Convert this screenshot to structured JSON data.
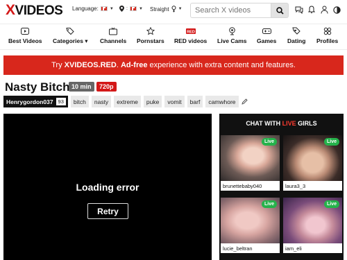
{
  "header": {
    "logo_x": "X",
    "logo_rest": "VIDEOS",
    "language_label": "Language:",
    "location_label": "▾",
    "orientation_label": "Straight",
    "search_placeholder": "Search X videos"
  },
  "nav": {
    "items": [
      {
        "label": "Best Videos",
        "icon": "play-box-icon"
      },
      {
        "label": "Categories ▾",
        "icon": "tags-icon"
      },
      {
        "label": "Channels",
        "icon": "tv-icon"
      },
      {
        "label": "Pornstars",
        "icon": "star-icon"
      },
      {
        "label": "RED videos",
        "icon": "red-badge-icon"
      },
      {
        "label": "Live Cams",
        "icon": "webcam-icon"
      },
      {
        "label": "Games",
        "icon": "gamepad-icon"
      },
      {
        "label": "Dating",
        "icon": "heart-tag-icon"
      },
      {
        "label": "Profiles",
        "icon": "profiles-icon"
      }
    ]
  },
  "promo": {
    "pre": "Try ",
    "brand": "XVIDEOS.RED",
    "mid": ". ",
    "bold": "Ad-free",
    "post": " experience with extra content and features."
  },
  "video": {
    "title": "Nasty Bitch",
    "duration": "10 min",
    "quality": "720p",
    "uploader": "Henrygordon037",
    "uploader_count": "93",
    "tags": [
      "bitch",
      "nasty",
      "extreme",
      "puke",
      "vomit",
      "barf",
      "camwhore"
    ]
  },
  "player": {
    "error_text": "Loading error",
    "retry_label": "Retry"
  },
  "live": {
    "head_pre": "CHAT WITH ",
    "head_red": "LIVE",
    "head_post": " GIRLS",
    "pill": "Live",
    "cams": [
      {
        "name": "brunettebaby040"
      },
      {
        "name": "laura3_3"
      },
      {
        "name": "lucie_beltran"
      },
      {
        "name": "iam_eli"
      }
    ]
  },
  "colors": {
    "brand_red": "#d31818",
    "promo_red": "#d8271c",
    "live_green": "#25b24b"
  }
}
